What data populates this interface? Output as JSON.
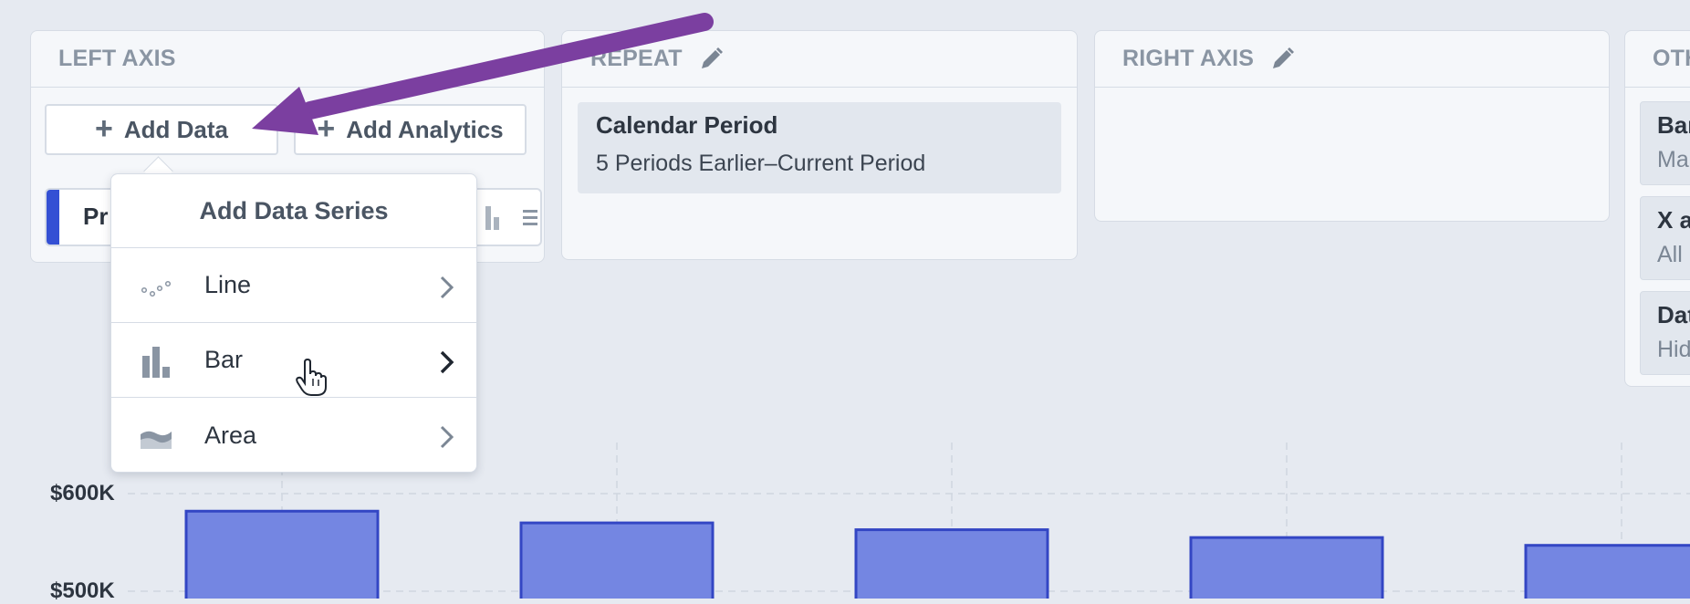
{
  "panels": {
    "left_axis": {
      "title": "LEFT AXIS"
    },
    "repeat": {
      "title": "REPEAT",
      "item": {
        "title": "Calendar Period",
        "subtitle": "5 Periods Earlier–Current Period"
      }
    },
    "right_axis": {
      "title": "RIGHT AXIS"
    },
    "other": {
      "title": "OTH",
      "items": [
        {
          "title": "Bar",
          "subtitle": "Ma"
        },
        {
          "title": "X a",
          "subtitle": "All"
        },
        {
          "title": "Dat",
          "subtitle": "Hid"
        }
      ]
    }
  },
  "toolbar": {
    "add_data_label": "Add Data",
    "add_analytics_label": "Add Analytics",
    "plus_glyph": "+"
  },
  "series_card": {
    "name": "Pr",
    "accent_color": "#3450d4"
  },
  "dropdown": {
    "title": "Add Data Series",
    "items": [
      {
        "label": "Line",
        "icon": "line-icon"
      },
      {
        "label": "Bar",
        "icon": "bar-chart-icon"
      },
      {
        "label": "Area",
        "icon": "area-icon"
      }
    ]
  },
  "annotation": {
    "arrow_color": "#7b3fa0"
  },
  "chart_data": {
    "type": "bar",
    "ylabels": [
      "$600K",
      "$500K"
    ],
    "values": [
      582000,
      570000,
      563000,
      555000,
      547000
    ],
    "ylim": [
      480000,
      620000
    ],
    "bar_color": "#7486e2",
    "bar_stroke": "#3346c4",
    "grid": true
  }
}
